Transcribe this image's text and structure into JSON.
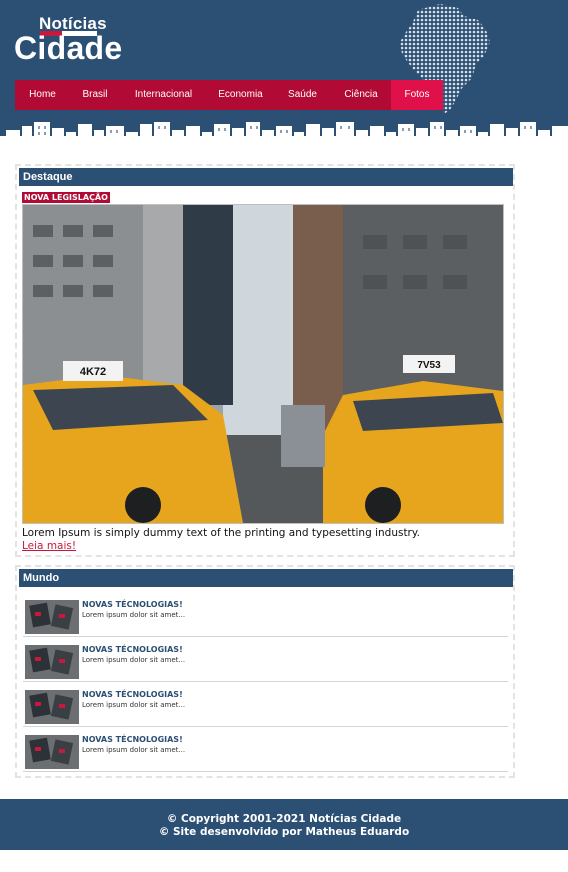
{
  "brand": {
    "top": "Notícias",
    "main": "Cidade"
  },
  "nav": {
    "items": [
      {
        "label": "Home"
      },
      {
        "label": "Brasil"
      },
      {
        "label": "Internacional"
      },
      {
        "label": "Economia"
      },
      {
        "label": "Saúde"
      },
      {
        "label": "Ciência"
      },
      {
        "label": "Fotos"
      }
    ]
  },
  "destaque": {
    "heading": "Destaque",
    "tag": "NOVA LEGISLAÇÃO",
    "taxi_plates": [
      "4K72",
      "7V53"
    ],
    "text": "Lorem Ipsum is simply dummy text of the printing and typesetting industry.",
    "link": "Leia mais!"
  },
  "mundo": {
    "heading": "Mundo",
    "items": [
      {
        "title": "NOVAS TÉCNOLOGIAS!",
        "text": "Lorem ipsum dolor sit amet..."
      },
      {
        "title": "NOVAS TÉCNOLOGIAS!",
        "text": "Lorem ipsum dolor sit amet..."
      },
      {
        "title": "NOVAS TÉCNOLOGIAS!",
        "text": "Lorem ipsum dolor sit amet..."
      },
      {
        "title": "NOVAS TÉCNOLOGIAS!",
        "text": "Lorem ipsum dolor sit amet..."
      }
    ]
  },
  "footer": {
    "line1": "© Copyright 2001-2021 Notícias Cidade",
    "line2": "© Site desenvolvido por Matheus Eduardo"
  },
  "colors": {
    "primary": "#2c4f74",
    "accent": "#b10a34",
    "accent_active": "#e0114a",
    "taxi": "#e7a51d"
  },
  "icons": {
    "brand_mark": "brazil-map-icon",
    "skyline": "city-skyline-icon"
  }
}
